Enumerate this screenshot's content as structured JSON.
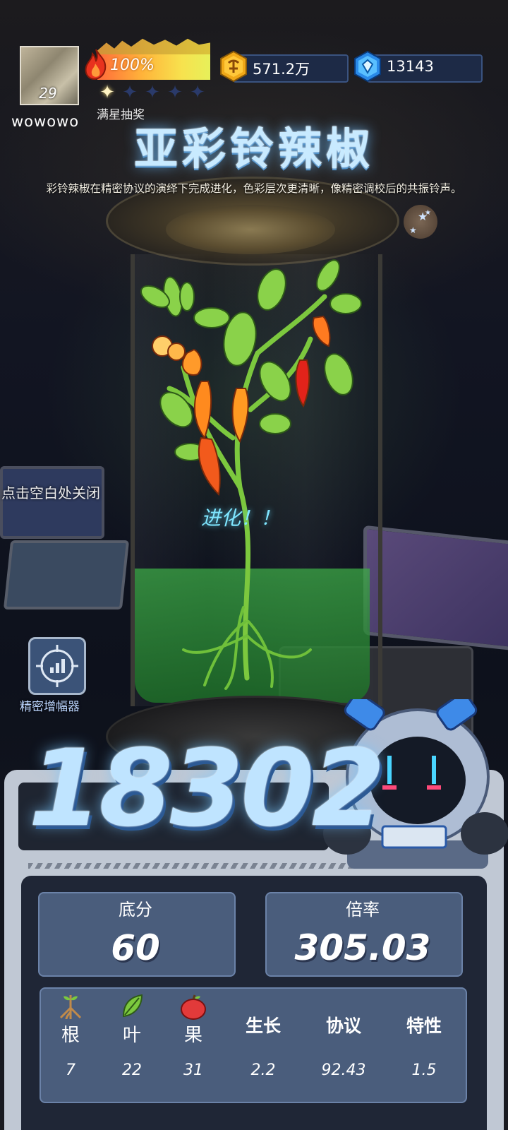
{
  "player": {
    "level": "29",
    "username": "wowowo"
  },
  "energy": {
    "percent_label": "100%",
    "fill": 1.0
  },
  "stars": {
    "total": 5,
    "lit": 1,
    "label": "满星抽奖"
  },
  "currency": {
    "coins": "571.2万",
    "gems": "13143"
  },
  "plant": {
    "name": "亚彩铃辣椒",
    "description": "彩铃辣椒在精密协议的演绎下完成进化，色彩层次更清晰，像精密调校后的共振铃声。",
    "evolve_text": "进化！！"
  },
  "hints": {
    "close": "点击空白处关闭"
  },
  "amplifier": {
    "label": "精密增幅器",
    "icon": "amplifier-chart-icon"
  },
  "result": {
    "total_score": "18302",
    "base_score_label": "底分",
    "base_score": "60",
    "multiplier_label": "倍率",
    "multiplier": "305.03"
  },
  "attributes": [
    {
      "name": "根",
      "value": "7",
      "icon": "root-icon"
    },
    {
      "name": "叶",
      "value": "22",
      "icon": "leaf-icon"
    },
    {
      "name": "果",
      "value": "31",
      "icon": "fruit-icon"
    },
    {
      "name": "生长",
      "value": "2.2",
      "icon": ""
    },
    {
      "name": "协议",
      "value": "92.43",
      "icon": ""
    },
    {
      "name": "特性",
      "value": "1.5",
      "icon": ""
    }
  ],
  "colors": {
    "title_glow": "#6ebeff",
    "stat_panel": "#4a5d7c",
    "frame": "#c0c8d4"
  }
}
